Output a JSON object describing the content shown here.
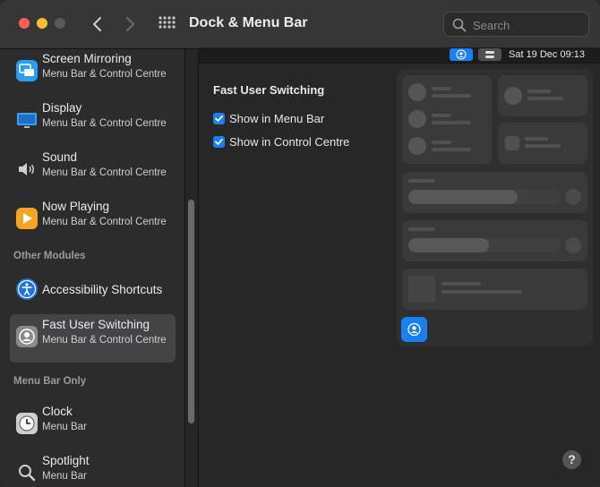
{
  "window": {
    "title": "Dock & Menu Bar",
    "search_placeholder": "Search"
  },
  "sidebar": {
    "items_top": [
      {
        "title": "Screen Mirroring",
        "subtitle": "Menu Bar & Control Centre",
        "icon": "screen-mirroring-icon"
      },
      {
        "title": "Display",
        "subtitle": "Menu Bar & Control Centre",
        "icon": "display-icon"
      },
      {
        "title": "Sound",
        "subtitle": "Menu Bar & Control Centre",
        "icon": "sound-icon"
      },
      {
        "title": "Now Playing",
        "subtitle": "Menu Bar & Control Centre",
        "icon": "now-playing-icon"
      }
    ],
    "other_modules_header": "Other Modules",
    "other_modules": [
      {
        "title": "Accessibility Shortcuts",
        "icon": "accessibility-icon"
      },
      {
        "title": "Fast User Switching",
        "subtitle": "Menu Bar & Control Centre",
        "icon": "user-switching-icon",
        "selected": true
      }
    ],
    "menu_bar_only_header": "Menu Bar Only",
    "menu_bar_only": [
      {
        "title": "Clock",
        "subtitle": "Menu Bar",
        "icon": "clock-icon"
      },
      {
        "title": "Spotlight",
        "subtitle": "Menu Bar",
        "icon": "spotlight-icon"
      }
    ]
  },
  "menubar_preview": {
    "date_time": "Sat 19 Dec  09:13"
  },
  "main": {
    "section_title": "Fast User Switching",
    "checkboxes": [
      {
        "label": "Show in Menu Bar",
        "checked": true
      },
      {
        "label": "Show in Control Centre",
        "checked": true
      }
    ]
  },
  "help_label": "?",
  "colors": {
    "accent": "#1a7ef5",
    "selected_row": "#444446",
    "traffic_red": "#fe5f57",
    "traffic_yellow": "#febc2e"
  }
}
